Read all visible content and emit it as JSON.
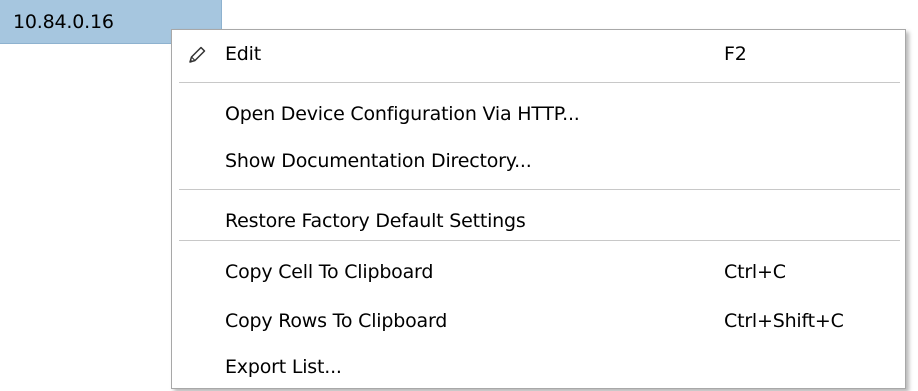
{
  "cell": {
    "value": "10.84.0.16"
  },
  "menu": {
    "edit": {
      "label": "Edit",
      "shortcut": "F2",
      "icon": "pencil-icon"
    },
    "open_config": {
      "label": "Open Device Configuration Via HTTP..."
    },
    "show_docs": {
      "label": "Show Documentation Directory..."
    },
    "restore_defaults": {
      "label": "Restore Factory Default Settings"
    },
    "copy_cell": {
      "label": "Copy Cell To Clipboard",
      "shortcut": "Ctrl+C"
    },
    "copy_rows": {
      "label": "Copy Rows To Clipboard",
      "shortcut": "Ctrl+Shift+C"
    },
    "export_list": {
      "label": "Export List..."
    }
  },
  "colors": {
    "selected_cell": "#a6c6df",
    "menu_border": "#a8a8a8",
    "separator": "#c8c8c8"
  }
}
